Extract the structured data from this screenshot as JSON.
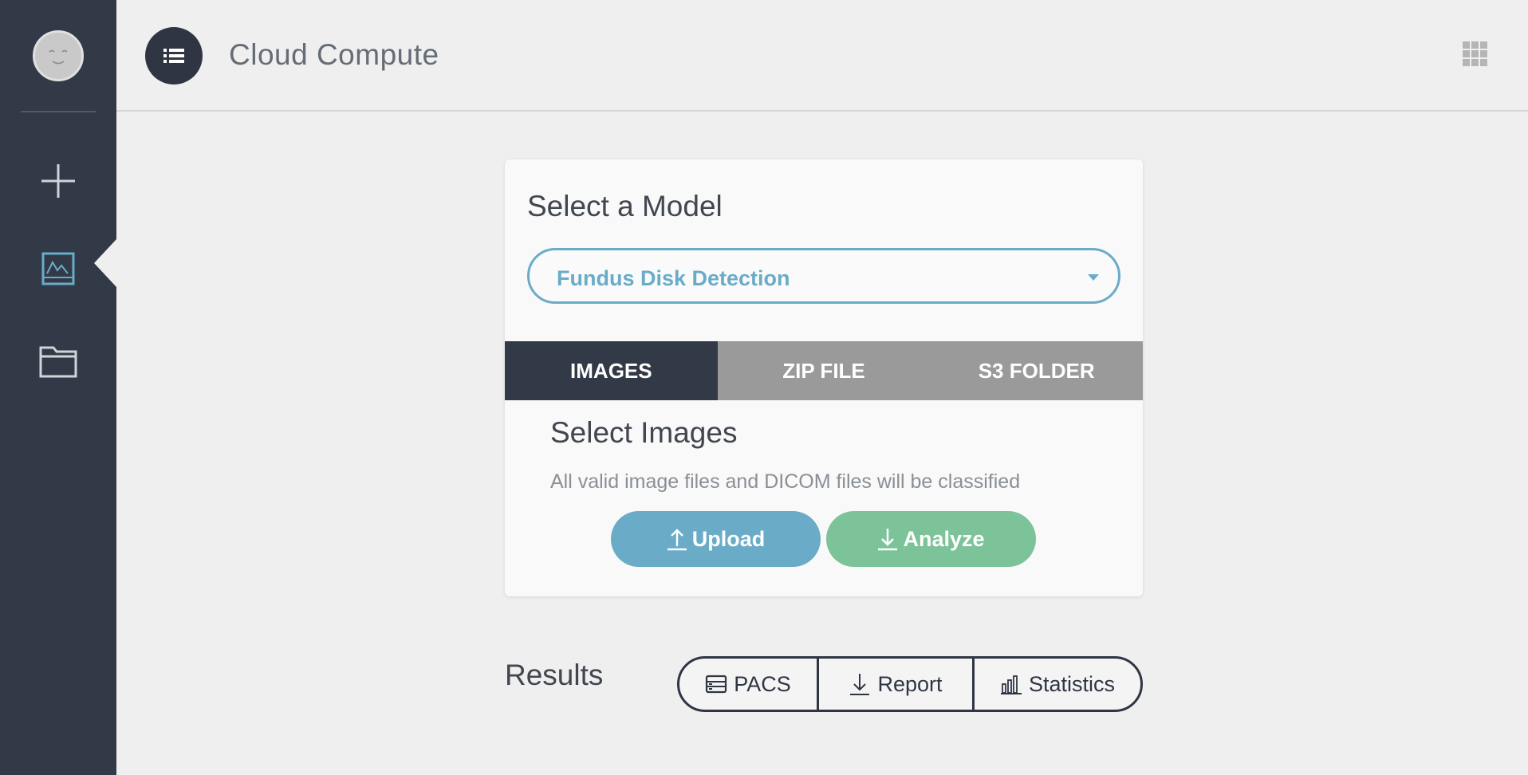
{
  "app": {
    "title": "Cloud Compute"
  },
  "sidebar": {
    "items": [
      {
        "name": "add",
        "icon": "plus-icon"
      },
      {
        "name": "images",
        "icon": "image-icon",
        "active": true
      },
      {
        "name": "files",
        "icon": "folder-icon"
      }
    ]
  },
  "model": {
    "heading": "Select a Model",
    "selected": "Fundus Disk Detection"
  },
  "tabs": [
    {
      "label": "IMAGES",
      "active": true
    },
    {
      "label": "ZIP FILE",
      "active": false
    },
    {
      "label": "S3 FOLDER",
      "active": false
    }
  ],
  "images_section": {
    "heading": "Select Images",
    "description": "All valid image files and DICOM files will be classified",
    "upload_label": "Upload",
    "analyze_label": "Analyze"
  },
  "results": {
    "heading": "Results",
    "pacs_label": "PACS",
    "report_label": "Report",
    "statistics_label": "Statistics"
  },
  "colors": {
    "sidebar": "#333a47",
    "accent_blue": "#6aacc8",
    "accent_green": "#7dc39a",
    "tab_inactive": "#9a9a9a"
  }
}
